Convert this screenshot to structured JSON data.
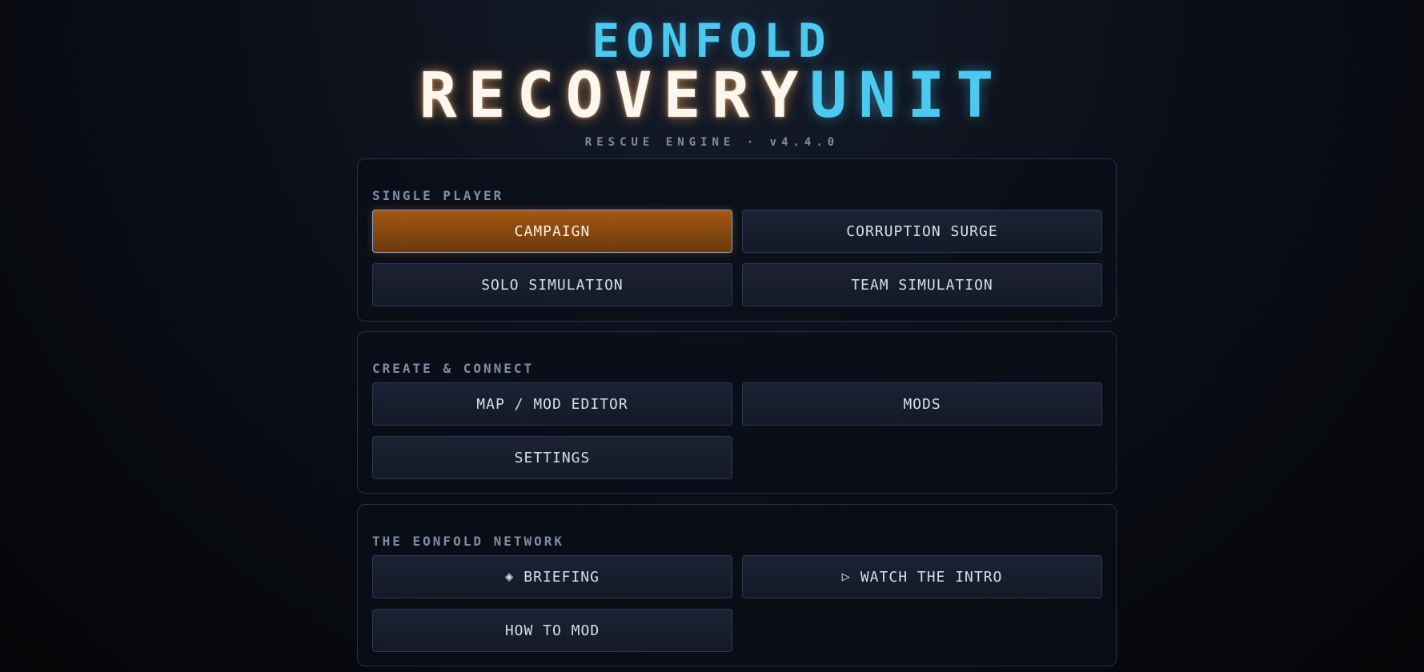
{
  "header": {
    "title_line1": "EONFOLD",
    "title_line2_a": "RECOVERY",
    "title_line2_b": "UNIT",
    "subtitle": "RESCUE ENGINE · v4.4.0"
  },
  "sections": [
    {
      "label": "SINGLE PLAYER",
      "buttons": [
        {
          "label": "CAMPAIGN",
          "active": true
        },
        {
          "label": "CORRUPTION SURGE"
        },
        {
          "label": "SOLO SIMULATION"
        },
        {
          "label": "TEAM SIMULATION"
        }
      ]
    },
    {
      "label": "CREATE & CONNECT",
      "buttons": [
        {
          "label": "MAP / MOD EDITOR"
        },
        {
          "label": "MODS"
        },
        {
          "label": "SETTINGS"
        }
      ]
    },
    {
      "label": "THE EONFOLD NETWORK",
      "buttons": [
        {
          "label": "BRIEFING",
          "glyph": "◈",
          "icon": "diamond-icon"
        },
        {
          "label": "WATCH THE INTRO",
          "glyph": "▷",
          "icon": "play-icon"
        },
        {
          "label": "HOW TO MOD"
        }
      ]
    }
  ],
  "colors": {
    "accent_cyan": "#4cc9f0",
    "active_orange": "#a35812",
    "panel_border": "#22304a"
  }
}
